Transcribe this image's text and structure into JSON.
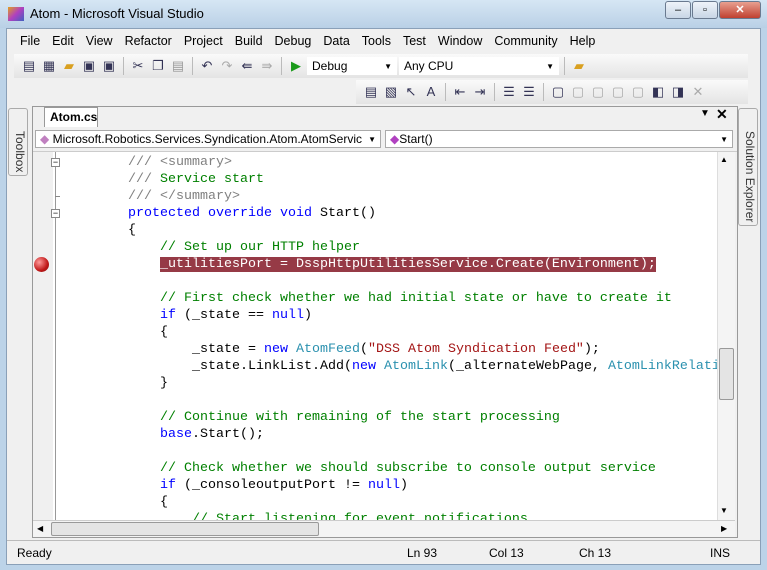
{
  "window": {
    "title": "Atom - Microsoft Visual Studio",
    "minimize": "–",
    "maximize": "▫",
    "close": "✕"
  },
  "menu": [
    "File",
    "Edit",
    "View",
    "Refactor",
    "Project",
    "Build",
    "Debug",
    "Data",
    "Tools",
    "Test",
    "Window",
    "Community",
    "Help"
  ],
  "toolbar": {
    "config": "Debug",
    "platform": "Any CPU"
  },
  "doc": {
    "tab": "Atom.cs",
    "class_combo": "Microsoft.Robotics.Services.Syndication.Atom.AtomServic",
    "member_combo": "Start()"
  },
  "side": {
    "left": "Toolbox",
    "right": "Solution Explorer"
  },
  "code": {
    "lines": [
      {
        "i": 0,
        "fold": "minus",
        "k": [
          [
            "dc",
            "/// "
          ],
          [
            "dc",
            "<summary>"
          ]
        ]
      },
      {
        "i": 0,
        "k": [
          [
            "dc",
            "/// "
          ],
          [
            "cm",
            "Service start"
          ]
        ]
      },
      {
        "i": 0,
        "fold": "end",
        "k": [
          [
            "dc",
            "/// </summary>"
          ]
        ]
      },
      {
        "i": 0,
        "fold": "minus",
        "k": [
          [
            "kw",
            "protected override void "
          ],
          [
            "pl",
            "Start()"
          ]
        ]
      },
      {
        "i": 0,
        "k": [
          [
            "pl",
            "{"
          ]
        ]
      },
      {
        "i": 1,
        "k": [
          [
            "cm",
            "// Set up our HTTP helper"
          ]
        ]
      },
      {
        "i": 1,
        "bp": true,
        "k": [
          [
            "bp",
            "_utilitiesPort = DsspHttpUtilitiesService.Create(Environment);"
          ]
        ]
      },
      {
        "i": 1,
        "k": []
      },
      {
        "i": 1,
        "k": [
          [
            "cm",
            "// First check whether we had initial state or have to create it"
          ]
        ]
      },
      {
        "i": 1,
        "k": [
          [
            "kw",
            "if"
          ],
          [
            "pl",
            " (_state == "
          ],
          [
            "kw",
            "null"
          ],
          [
            "pl",
            ")"
          ]
        ]
      },
      {
        "i": 1,
        "k": [
          [
            "pl",
            "{"
          ]
        ]
      },
      {
        "i": 2,
        "k": [
          [
            "pl",
            "_state = "
          ],
          [
            "kw",
            "new "
          ],
          [
            "ty",
            "AtomFeed"
          ],
          [
            "pl",
            "("
          ],
          [
            "st",
            "\"DSS Atom Syndication Feed\""
          ],
          [
            "pl",
            ");"
          ]
        ]
      },
      {
        "i": 2,
        "k": [
          [
            "pl",
            "_state.LinkList.Add("
          ],
          [
            "kw",
            "new "
          ],
          [
            "ty",
            "AtomLink"
          ],
          [
            "pl",
            "(_alternateWebPage, "
          ],
          [
            "ty",
            "AtomLinkRelation"
          ]
        ]
      },
      {
        "i": 1,
        "k": [
          [
            "pl",
            "}"
          ]
        ]
      },
      {
        "i": 1,
        "k": []
      },
      {
        "i": 1,
        "k": [
          [
            "cm",
            "// Continue with remaining of the start processing"
          ]
        ]
      },
      {
        "i": 1,
        "k": [
          [
            "kw",
            "base"
          ],
          [
            "pl",
            ".Start();"
          ]
        ]
      },
      {
        "i": 1,
        "k": []
      },
      {
        "i": 1,
        "k": [
          [
            "cm",
            "// Check whether we should subscribe to console output service"
          ]
        ]
      },
      {
        "i": 1,
        "k": [
          [
            "kw",
            "if"
          ],
          [
            "pl",
            " (_consoleoutputPort != "
          ],
          [
            "kw",
            "null"
          ],
          [
            "pl",
            ")"
          ]
        ]
      },
      {
        "i": 1,
        "k": [
          [
            "pl",
            "{"
          ]
        ]
      },
      {
        "i": 2,
        "k": [
          [
            "cm",
            "// Start listening for event notifications"
          ]
        ]
      }
    ]
  },
  "status": {
    "text": "Ready",
    "ln": "Ln 93",
    "col": "Col 13",
    "ch": "Ch 13",
    "mode": "INS"
  }
}
